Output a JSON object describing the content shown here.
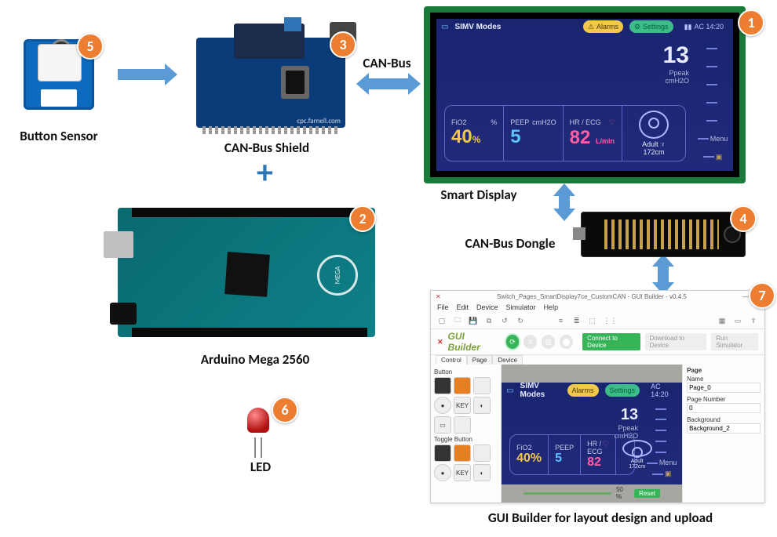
{
  "components": {
    "button_sensor": {
      "label": "Button Sensor",
      "badge": "5"
    },
    "can_shield": {
      "label": "CAN-Bus Shield",
      "badge": "3",
      "footnote": "cpc.farnell.com"
    },
    "arduino": {
      "label": "Arduino Mega 2560",
      "badge": "2",
      "brand": "MEGA"
    },
    "led": {
      "label": "LED",
      "badge": "6"
    },
    "smart_display": {
      "label": "Smart Display",
      "badge": "1"
    },
    "dongle": {
      "label": "CAN-Bus Dongle",
      "badge": "4"
    },
    "gui": {
      "label": "GUI Builder for layout design and upload",
      "badge": "7"
    }
  },
  "connections": {
    "canbus_label": "CAN-Bus"
  },
  "display_ui": {
    "title": "SIMV Modes",
    "topbar": {
      "alarms": "Alarms",
      "settings": "Settings",
      "battery": "AC 14:20"
    },
    "readout": {
      "value": "13",
      "label": "Ppeak",
      "unit": "cmH2O"
    },
    "cells": {
      "fio2": {
        "title": "FiO2",
        "value": "40",
        "unit": "%",
        "color": "#f2c84b"
      },
      "peep": {
        "title": "PEEP",
        "value": "5",
        "unit": "cmH2O",
        "color": "#5ac3ff"
      },
      "hr": {
        "title": "HR / ECG",
        "value": "82",
        "unit": "L/min",
        "color": "#ff5fa2"
      },
      "patient": {
        "line1": "Adult",
        "line2": "172cm"
      }
    },
    "side_items": [
      "—",
      "—",
      "—",
      "—",
      "—",
      "Menu",
      "A"
    ]
  },
  "gui_builder": {
    "window_title": "Switch_Pages_SmartDisplay7ce_CustomCAN - GUI Builder - v0.4.5",
    "minmax": "— □ ×",
    "menu": [
      "File",
      "Edit",
      "Device",
      "Simulator",
      "Help"
    ],
    "brand": "GUI Builder",
    "buttons": {
      "connect": "Connect to Device",
      "download": "Download to Device",
      "run": "Run Simulator"
    },
    "left_tabs": [
      "Control",
      "Page",
      "Device"
    ],
    "palette_groups": {
      "button": "Button",
      "toggle": "Toggle Button"
    },
    "zoom": {
      "value": "50 %",
      "reset": "Reset"
    },
    "props": {
      "heading": "Page",
      "name_label": "Name",
      "name_value": "Page_0",
      "pagenum_label": "Page Number",
      "pagenum_value": "0",
      "bg_label": "Background",
      "bg_value": "Background_2"
    }
  }
}
